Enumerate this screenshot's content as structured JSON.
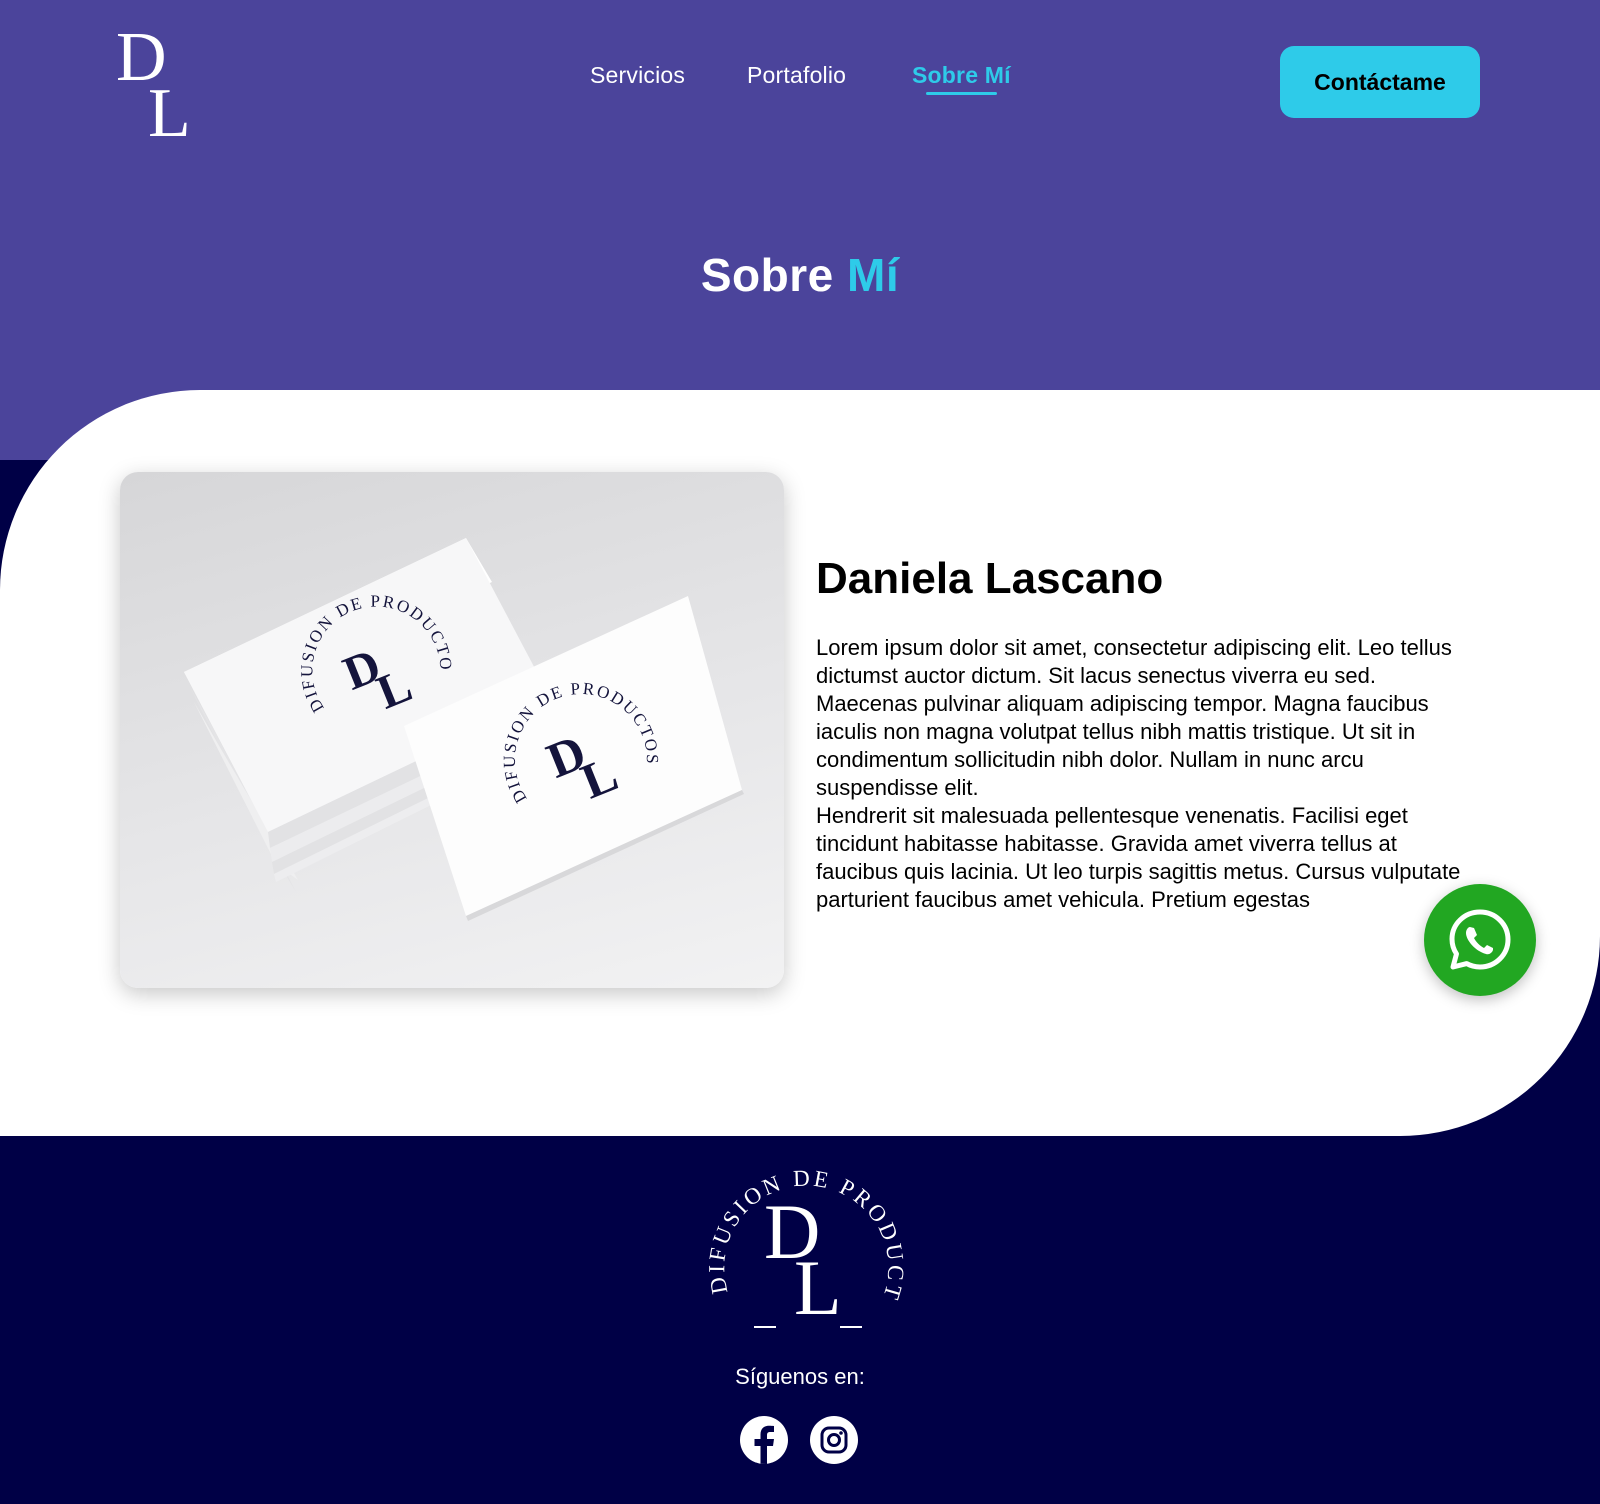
{
  "brand": {
    "logo_text": "DL"
  },
  "nav": {
    "items": [
      {
        "label": "Servicios",
        "active": false
      },
      {
        "label": "Portafolio",
        "active": false
      },
      {
        "label": "Sobre Mí",
        "active": true
      }
    ],
    "cta_label": "Contáctame"
  },
  "hero": {
    "title_main": "Sobre",
    "title_accent": "Mí"
  },
  "about": {
    "name": "Daniela Lascano",
    "paragraph_1": "Lorem ipsum dolor sit amet, consectetur adipiscing elit. Leo tellus dictumst auctor dictum. Sit lacus senectus viverra eu sed. Maecenas pulvinar aliquam adipiscing tempor. Magna faucibus iaculis non magna volutpat tellus nibh mattis tristique. Ut sit in condimentum sollicitudin nibh dolor. Nullam in nunc arcu suspendisse elit.",
    "paragraph_2": "Hendrerit sit malesuada pellentesque venenatis. Facilisi eget tincidunt habitasse habitasse. Gravida amet viverra tellus at faucibus quis lacinia. Ut leo turpis sagittis metus. Cursus vulputate parturient faucibus amet vehicula. Pretium egestas",
    "image": {
      "subject": "business-cards-mockup",
      "card_text": "DIFUSION DE PRODUCTOS",
      "card_logo": "DL"
    }
  },
  "footer": {
    "logo_ring_text": "DIFUSION DE PRODUCTOS",
    "logo_monogram": "DL",
    "follow_label": "Síguenos en:",
    "social": [
      {
        "icon": "facebook-icon"
      },
      {
        "icon": "instagram-icon"
      }
    ]
  },
  "floating": {
    "icon": "whatsapp-icon"
  },
  "colors": {
    "hero_bg": "#4B449B",
    "accent": "#2ECBE9",
    "footer_bg": "#000046",
    "whatsapp": "#22A722",
    "card_ink": "#14143C"
  }
}
